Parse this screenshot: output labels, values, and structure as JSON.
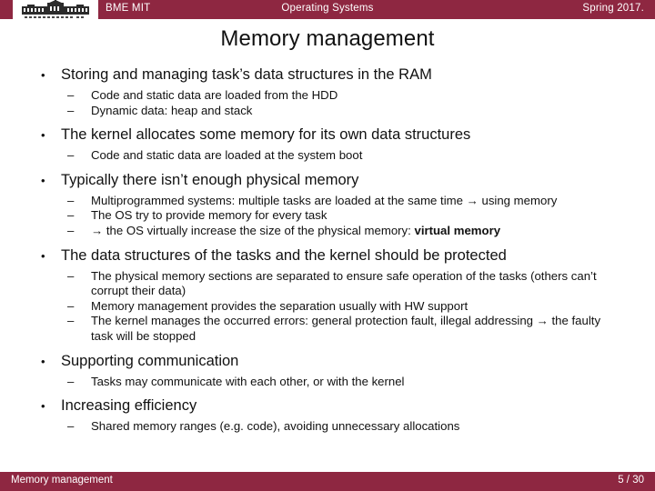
{
  "colors": {
    "bar": "#8e2741",
    "bar_text": "#ffffff",
    "body_text": "#111111",
    "background": "#ffffff"
  },
  "header": {
    "logo_alt": "BME main building logo",
    "left": "BME MIT",
    "center": "Operating Systems",
    "right": "Spring 2017."
  },
  "title": "Memory management",
  "bullets": [
    {
      "text": "Storing and managing task’s data structures in the RAM",
      "sub": [
        {
          "text": "Code and static data are loaded from the HDD"
        },
        {
          "text": "Dynamic data: heap and stack"
        }
      ]
    },
    {
      "text": "The kernel allocates some memory for its own data structures",
      "sub": [
        {
          "text": "Code and static data are loaded at the system boot"
        }
      ]
    },
    {
      "text": "Typically there isn’t enough physical memory",
      "sub": [
        {
          "text": "Multiprogrammed systems: multiple tasks are loaded at the same time → using memory"
        },
        {
          "text": "The OS try to provide memory for every task"
        },
        {
          "pre": "→ the OS virtually increase the size of the physical memory: ",
          "bold": "virtual memory"
        }
      ]
    },
    {
      "text": "The data structures of the tasks and the kernel should be protected",
      "sub": [
        {
          "text": "The physical memory sections are separated to ensure safe operation of the tasks (others can’t corrupt their data)"
        },
        {
          "text": "Memory management provides the separation usually with HW support"
        },
        {
          "text": "The kernel manages the occurred errors: general protection fault, illegal addressing → the faulty task will be stopped"
        }
      ]
    },
    {
      "text": "Supporting communication",
      "sub": [
        {
          "text": "Tasks may communicate with each other, or with the kernel"
        }
      ]
    },
    {
      "text": "Increasing efficiency",
      "sub": [
        {
          "text": "Shared memory ranges (e.g. code), avoiding unnecessary allocations"
        }
      ]
    }
  ],
  "glyphs": {
    "bullet": "•",
    "dash": "–"
  },
  "footer": {
    "left": "Memory management",
    "page": "5 / 30"
  }
}
